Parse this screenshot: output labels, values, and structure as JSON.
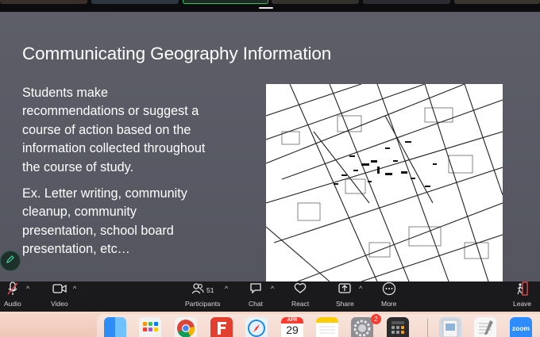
{
  "slide": {
    "title": "Communicating Geography Information",
    "paragraph1": [
      "Students make",
      "recommendations or suggest a",
      "course of action based on the",
      "information collected throughout",
      "the course of study."
    ],
    "paragraph2": [
      "Ex. Letter writing, community",
      "cleanup, community",
      "presentation, school board",
      "presentation, etc…"
    ]
  },
  "toolbar": {
    "audio": "Audio",
    "video": "Video",
    "participants": "Participants",
    "participant_count": "51",
    "chat": "Chat",
    "react": "React",
    "share": "Share",
    "more": "More",
    "leave": "Leave"
  },
  "dock": {
    "calendar_month": "APR",
    "calendar_day": "29",
    "settings_badge": "2",
    "zoom_label": "zoom"
  },
  "colors": {
    "slide_bg": "#5a5b65",
    "toolbar_bg": "#1a1a1c",
    "mute_red": "#e0484b",
    "leave_red": "#e0484b",
    "active_speaker_border": "#35c759"
  }
}
